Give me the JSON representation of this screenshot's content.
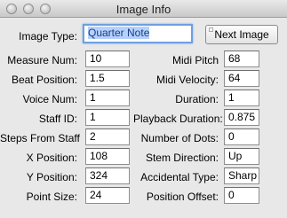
{
  "window": {
    "title": "Image Info"
  },
  "image_type": {
    "label": "Image Type:",
    "value": "Quarter Note"
  },
  "next_button": {
    "label": "Next Image"
  },
  "left_fields": [
    {
      "label": "Measure Num:",
      "value": "10"
    },
    {
      "label": "Beat Position:",
      "value": "1.5"
    },
    {
      "label": "Voice Num:",
      "value": "1"
    },
    {
      "label": "Staff ID:",
      "value": "1"
    },
    {
      "label": "Steps From Staff",
      "value": "2"
    },
    {
      "label": "X Position:",
      "value": "108"
    },
    {
      "label": "Y Position:",
      "value": "324"
    },
    {
      "label": "Point Size:",
      "value": "24"
    }
  ],
  "right_fields": [
    {
      "label": "Midi Pitch",
      "value": "68"
    },
    {
      "label": "Midi Velocity:",
      "value": "64"
    },
    {
      "label": "Duration:",
      "value": "1"
    },
    {
      "label": "Playback Duration:",
      "value": "0.875"
    },
    {
      "label": "Number of Dots:",
      "value": "0"
    },
    {
      "label": "Stem Direction:",
      "value": "Up"
    },
    {
      "label": "Accidental Type:",
      "value": "Sharp"
    },
    {
      "label": "Position Offset:",
      "value": "0"
    }
  ]
}
